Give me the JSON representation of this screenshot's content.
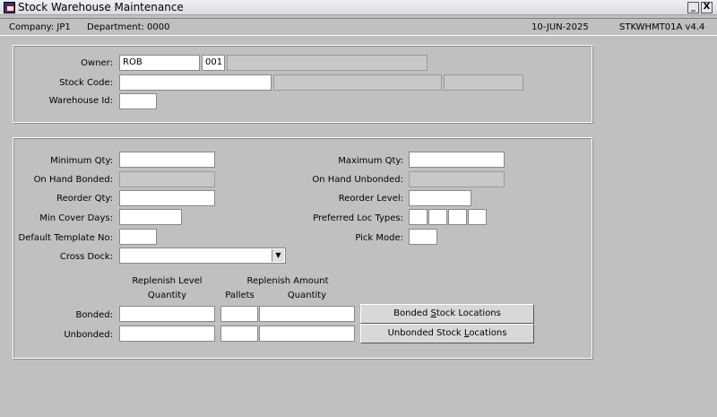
{
  "window": {
    "title": "Stock Warehouse Maintenance",
    "minimize": "_",
    "close": "X"
  },
  "infobar": {
    "company": "Company:  JP1",
    "department": "Department:  0000",
    "date": "10-JUN-2025",
    "form_id": "STKWHMT01A  v4.4"
  },
  "top": {
    "owner_label": "Owner:",
    "owner_value": "ROB",
    "owner_code": "001",
    "owner_desc": "",
    "stock_code_label": "Stock Code:",
    "stock_code_value": "",
    "warehouse_label": "Warehouse Id:",
    "warehouse_value": ""
  },
  "main": {
    "min_qty_label": "Minimum Qty:",
    "on_hand_bonded_label": "On Hand Bonded:",
    "reorder_qty_label": "Reorder Qty:",
    "min_cover_label": "Min Cover Days:",
    "default_template_label": "Default Template No:",
    "cross_dock_label": "Cross Dock:",
    "max_qty_label": "Maximum Qty:",
    "on_hand_unbonded_label": "On Hand Unbonded:",
    "reorder_level_label": "Reorder Level:",
    "pref_loc_label": "Preferred Loc Types:",
    "pick_mode_label": "Pick Mode:"
  },
  "replenish": {
    "level_header": "Replenish Level",
    "amount_header": "Replenish Amount",
    "quantity_header": "Quantity",
    "pallets_header": "Pallets",
    "quantity2_header": "Quantity",
    "bonded_label": "Bonded:",
    "unbonded_label": "Unbonded:",
    "bonded_btn_pre": "Bonded ",
    "bonded_btn_u": "S",
    "bonded_btn_post": "tock Locations",
    "unbonded_btn_pre": "Unbonded Stock ",
    "unbonded_btn_u": "L",
    "unbonded_btn_post": "ocations"
  }
}
